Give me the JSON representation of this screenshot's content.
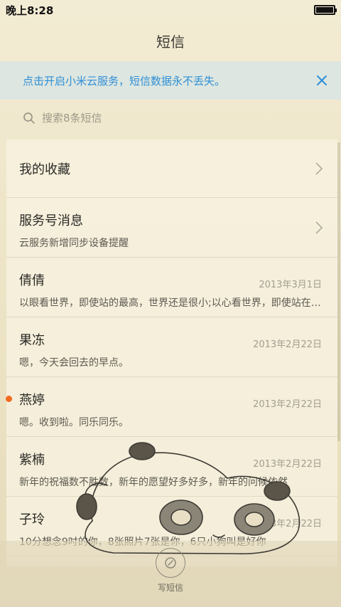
{
  "status_bar": {
    "time": "晚上8:28"
  },
  "header": {
    "title": "短信"
  },
  "banner": {
    "text": "点击开启小米云服务，短信数据永不丢失。"
  },
  "search": {
    "placeholder": "搜索8条短信"
  },
  "favorites": {
    "label": "我的收藏"
  },
  "service": {
    "title": "服务号消息",
    "subtitle": "云服务新增同步设备提醒"
  },
  "conversations": [
    {
      "name": "倩倩",
      "date": "2013年3月1日",
      "preview": "以眼看世界，即使站的最高，世界还是很小;以心看世界，即使站在最低，世界也是很大",
      "unread": false
    },
    {
      "name": "果冻",
      "date": "2013年2月22日",
      "preview": "嗯，今天会回去的早点。",
      "unread": false
    },
    {
      "name": "燕婷",
      "date": "2013年2月22日",
      "preview": "嗯。收到啦。同乐同乐。",
      "unread": true
    },
    {
      "name": "紫楠",
      "date": "2013年2月22日",
      "preview": "新年的祝福数不胜数，新年的愿望好多好多，新年的问候依然",
      "unread": false
    },
    {
      "name": "子玲",
      "date": "2013年2月22日",
      "preview": "10分想念9吋的你，8张照片7张是你，6只小狗叫是好你",
      "unread": false
    }
  ],
  "compose": {
    "label": "写短信"
  },
  "colors": {
    "accent": "#2f8fd6",
    "unread_dot": "#f26a21"
  },
  "battery_level": 1.0
}
